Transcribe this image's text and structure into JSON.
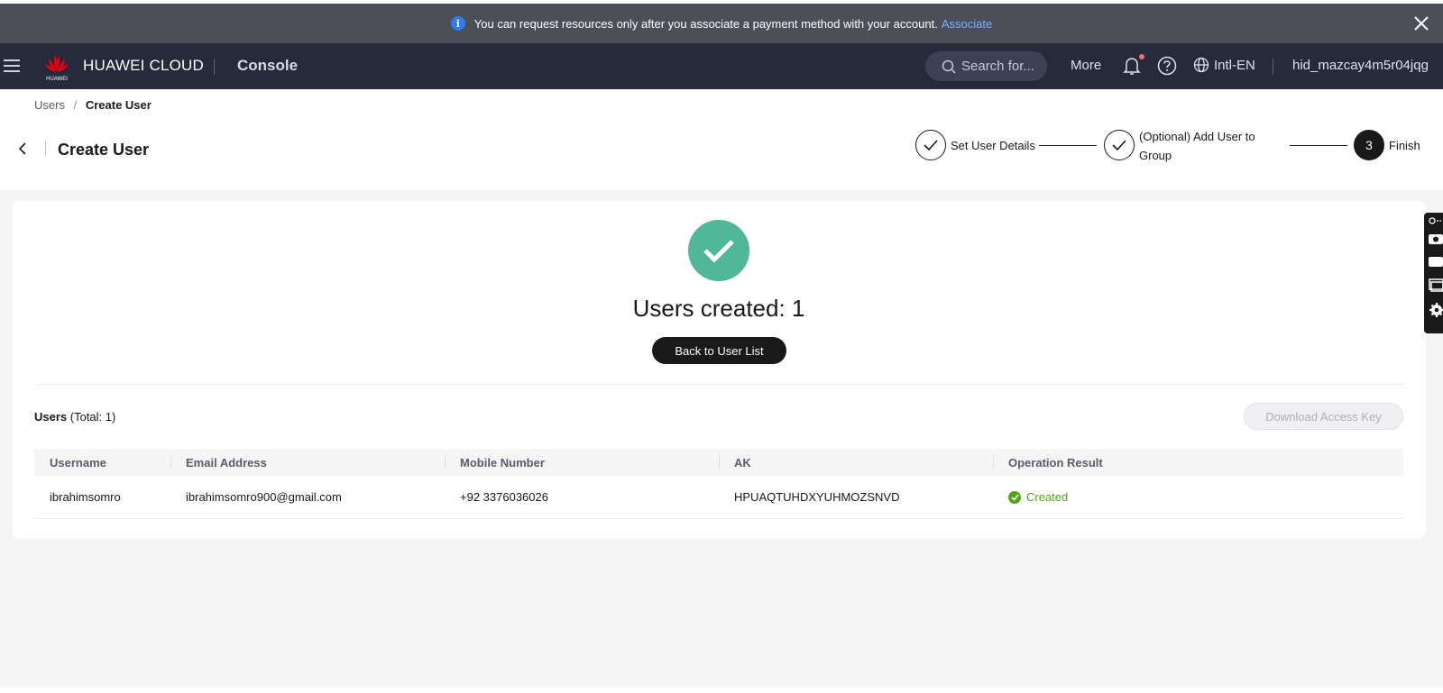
{
  "notice": {
    "message": "You can request resources only after you associate a payment method with your account.",
    "link": "Associate"
  },
  "navbar": {
    "brand": "HUAWEI CLOUD",
    "logo_text": "HUAWEI",
    "console": "Console",
    "search_placeholder": "Search for...",
    "more": "More",
    "language": "Intl-EN",
    "account": "hid_mazcay4m5r04jqg"
  },
  "breadcrumb": {
    "parent": "Users",
    "separator": "/",
    "current": "Create User"
  },
  "page": {
    "title": "Create User"
  },
  "steps": [
    {
      "label": "Set User Details",
      "state": "done"
    },
    {
      "label": "(Optional) Add User to Group",
      "state": "done"
    },
    {
      "number": "3",
      "label": "Finish",
      "state": "active"
    }
  ],
  "result": {
    "message": "Users created: 1",
    "back_button": "Back to User List"
  },
  "users_section": {
    "title": "Users",
    "total": "(Total: 1)",
    "download_button": "Download Access Key"
  },
  "table": {
    "columns": [
      "Username",
      "Email Address",
      "Mobile Number",
      "AK",
      "Operation Result"
    ],
    "rows": [
      {
        "username": "ibrahimsomro",
        "email": "ibrahimsomro900@gmail.com",
        "mobile": "+92 3376036026",
        "ak": "HPUAQTUHDXYUHMOZSNVD",
        "result": "Created"
      }
    ]
  },
  "colors": {
    "accent_success": "#50b798",
    "status_green": "#50a515",
    "navbar_bg": "#252b3a",
    "notice_bg": "#4c4f57",
    "link": "#7eb2ff",
    "huawei_red": "#e60012"
  }
}
